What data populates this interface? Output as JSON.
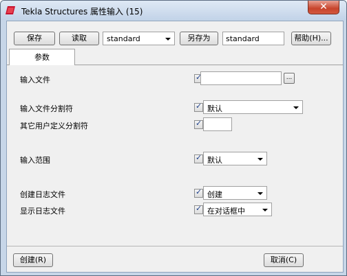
{
  "window": {
    "title": "Tekla Structures  属性输入 (15)",
    "close_glyph": "✕"
  },
  "toolbar": {
    "save_label": "保存",
    "load_label": "读取",
    "preset_value": "standard",
    "save_as_label": "另存为",
    "save_as_value": "standard",
    "help_label": "帮助(H)..."
  },
  "tabs": [
    {
      "label": "参数"
    }
  ],
  "fields": {
    "input_file": {
      "label": "输入文件",
      "checked": true,
      "value": "",
      "browse_label": "..."
    },
    "input_file_separator": {
      "label": "输入文件分割符",
      "checked": true,
      "value": "默认"
    },
    "other_separator": {
      "label": "其它用户定义分割符",
      "checked": true,
      "value": ""
    },
    "input_range": {
      "label": "输入范围",
      "checked": true,
      "value": "默认"
    },
    "create_log": {
      "label": "创建日志文件",
      "checked": true,
      "value": "创建"
    },
    "show_log": {
      "label": "显示日志文件",
      "checked": true,
      "value": "在对话框中"
    }
  },
  "footer": {
    "create_label": "创建(R)",
    "cancel_label": "取消(C)"
  },
  "icons": {
    "app": "tekla-app-icon",
    "checkbox_mark": "✓"
  },
  "colors": {
    "titlebar": "#c7d6e8",
    "close_button": "#c7442c",
    "checkmark": "#1d3f8a"
  }
}
